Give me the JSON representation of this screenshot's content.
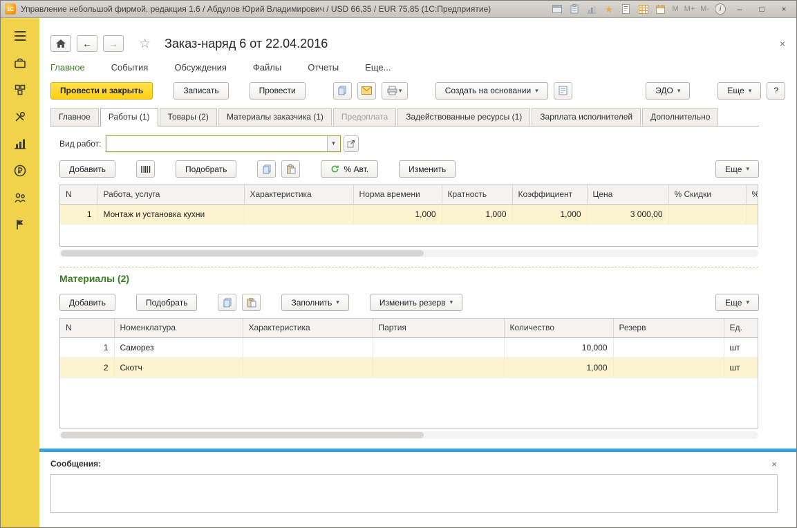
{
  "icons": {
    "caret_down": "▾",
    "back_arrow": "←",
    "forward_arrow": "→",
    "favorite_star": "☆",
    "titlebar_star": "★",
    "close": "×",
    "minimize": "–",
    "maximize": "□",
    "info": "i",
    "help": "?"
  },
  "titlebar": {
    "app_logo": "1С",
    "title": "Управление небольшой фирмой, редакция 1.6 / Абдулов Юрий Владимирович / USD 66,35 / EUR 75,85  (1С:Предприятие)",
    "calc_memory": [
      "М",
      "М+",
      "М-"
    ]
  },
  "nav": {
    "doc_title": "Заказ-наряд 6 от 22.04.2016"
  },
  "menu": {
    "items": [
      "Главное",
      "События",
      "Обсуждения",
      "Файлы",
      "Отчеты",
      "Еще..."
    ]
  },
  "commands": {
    "post_and_close": "Провести и закрыть",
    "write": "Записать",
    "post": "Провести",
    "create_based_on": "Создать на основании",
    "edo": "ЭДО",
    "more": "Еще"
  },
  "tabs": [
    "Главное",
    "Работы (1)",
    "Товары (2)",
    "Материалы заказчика (1)",
    "Предоплата",
    "Задействованные ресурсы (1)",
    "Зарплата исполнителей",
    "Дополнительно"
  ],
  "work_type": {
    "label": "Вид работ:",
    "value": ""
  },
  "works": {
    "toolbar": {
      "add": "Добавить",
      "pick": "Подобрать",
      "auto_discount": "% Авт.",
      "edit": "Изменить",
      "more": "Еще"
    },
    "headers": [
      "N",
      "Работа, услуга",
      "Характеристика",
      "Норма времени",
      "Кратность",
      "Коэффициент",
      "Цена",
      "% Скидки",
      "%"
    ],
    "rows": [
      {
        "n": "1",
        "name": "Монтаж и установка кухни",
        "characteristic": "",
        "time_norm": "1,000",
        "multiplicity": "1,000",
        "coefficient": "1,000",
        "price": "3 000,00",
        "discount": "",
        "extra": ""
      }
    ]
  },
  "materials": {
    "title": "Материалы (2)",
    "toolbar": {
      "add": "Добавить",
      "pick": "Подобрать",
      "fill": "Заполнить",
      "edit_reserve": "Изменить резерв",
      "more": "Еще"
    },
    "headers": [
      "N",
      "Номенклатура",
      "Характеристика",
      "Партия",
      "Количество",
      "Резерв",
      "Ед."
    ],
    "rows": [
      {
        "n": "1",
        "name": "Саморез",
        "characteristic": "",
        "batch": "",
        "quantity": "10,000",
        "reserve": "",
        "unit": "шт"
      },
      {
        "n": "2",
        "name": "Скотч",
        "characteristic": "",
        "batch": "",
        "quantity": "1,000",
        "reserve": "",
        "unit": "шт"
      }
    ]
  },
  "messages": {
    "label": "Сообщения:"
  }
}
